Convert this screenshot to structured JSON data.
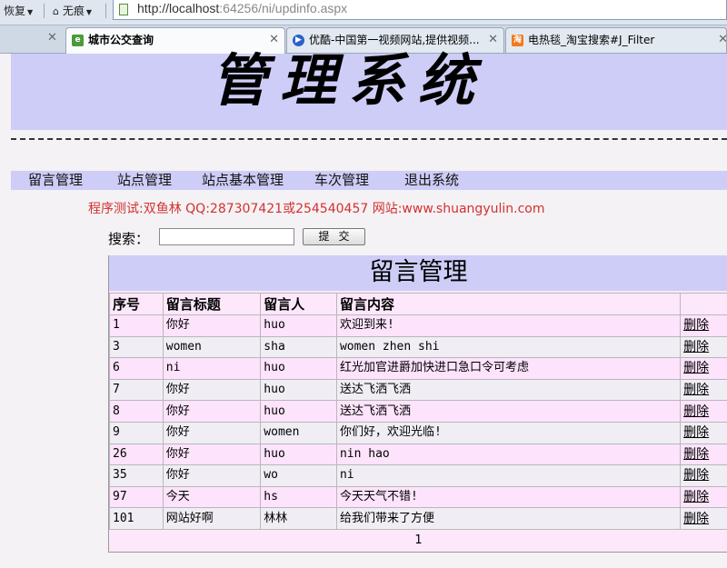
{
  "browser": {
    "back_label": "恢复",
    "traceless_label": "无痕",
    "url_host": "http://localhost",
    "url_rest": ":64256/ni/updinfo.aspx",
    "tabs": [
      {
        "label": "城市公交查询",
        "active": true
      },
      {
        "label": "优酷-中国第一视频网站,提供视频...",
        "active": false
      },
      {
        "label": "电热毯_淘宝搜索#J_Filter",
        "active": false
      }
    ]
  },
  "header": {
    "banner_title": "管理系统"
  },
  "nav": {
    "items": [
      "留言管理",
      "站点管理",
      "站点基本管理",
      "车次管理",
      "退出系统"
    ]
  },
  "notice": "程序测试:双鱼林 QQ:287307421或254540457 网站:www.shuangyulin.com",
  "search": {
    "label": "搜索：",
    "value": "",
    "button_label": "提交"
  },
  "grid": {
    "title": "留言管理",
    "columns": [
      "序号",
      "留言标题",
      "留言人",
      "留言内容",
      ""
    ],
    "delete_label": "删除",
    "rows": [
      {
        "id": "1",
        "title": "你好",
        "author": "huo",
        "content": "欢迎到来!"
      },
      {
        "id": "3",
        "title": "women",
        "author": "sha",
        "content": "women zhen shi"
      },
      {
        "id": "6",
        "title": "ni",
        "author": "huo",
        "content": "红光加官进爵加快进口急口令可考虑"
      },
      {
        "id": "7",
        "title": "你好",
        "author": "huo",
        "content": "送达飞洒飞洒"
      },
      {
        "id": "8",
        "title": "你好",
        "author": "huo",
        "content": "送达飞洒飞洒"
      },
      {
        "id": "9",
        "title": "你好",
        "author": "women",
        "content": "你们好，欢迎光临!"
      },
      {
        "id": "26",
        "title": "你好",
        "author": "huo",
        "content": "nin hao"
      },
      {
        "id": "35",
        "title": "你好",
        "author": "wo",
        "content": "ni"
      },
      {
        "id": "97",
        "title": "今天",
        "author": "hs",
        "content": "今天天气不错!"
      },
      {
        "id": "101",
        "title": "网站好啊",
        "author": "林林",
        "content": "给我们带来了方便"
      }
    ],
    "pager": "1"
  }
}
